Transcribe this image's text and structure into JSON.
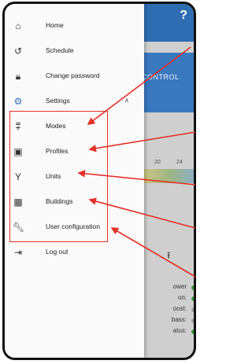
{
  "header": {
    "help_label": "?"
  },
  "background": {
    "control_label": "CONTROL",
    "chart_ticks": [
      "20",
      "24"
    ],
    "upload_icon": "upload-icon",
    "status_rows": [
      {
        "label": "ower",
        "color": "#3a9a3a"
      },
      {
        "label": "on:",
        "color": "#3a9a3a"
      },
      {
        "label": "oost:",
        "color": "#9a9a9a"
      },
      {
        "label": "bass:",
        "color": "#9a9a9a"
      },
      {
        "label": "atus:",
        "color": "#3a9a3a"
      }
    ]
  },
  "drawer": {
    "items": [
      {
        "label": "Home",
        "icon": "home-icon"
      },
      {
        "label": "Schedule",
        "icon": "history-icon"
      },
      {
        "label": "Change password",
        "icon": "lock-icon"
      },
      {
        "label": "Settings",
        "icon": "gear-icon"
      },
      {
        "label": "Modes",
        "icon": "modes-icon"
      },
      {
        "label": "Profiles",
        "icon": "calendar-icon"
      },
      {
        "label": "Units",
        "icon": "units-icon"
      },
      {
        "label": "Buildings",
        "icon": "building-icon"
      },
      {
        "label": "User configuration",
        "icon": "wrench-icon"
      },
      {
        "label": "Log out",
        "icon": "logout-icon"
      }
    ]
  },
  "colors": {
    "accent": "#2f6db3",
    "highlight": "#e53027"
  }
}
